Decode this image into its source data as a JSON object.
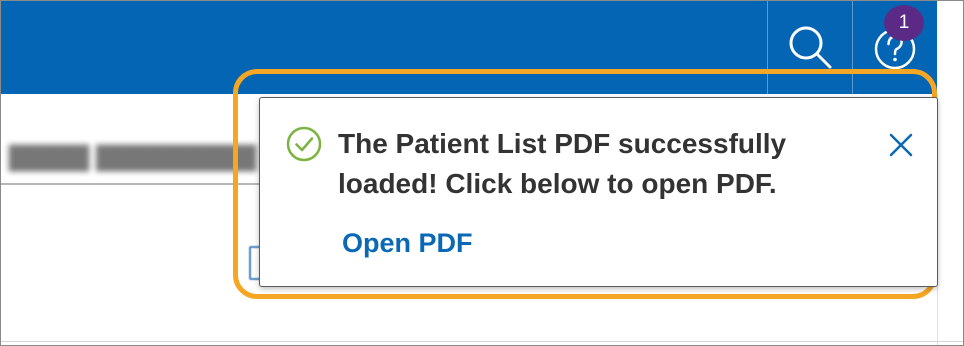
{
  "header": {
    "search_icon": "search-icon",
    "help_icon": "help-icon",
    "notification_count": "1",
    "bar_color": "#0365b4",
    "badge_color": "#5b2a86"
  },
  "toast": {
    "status_icon": "check-circle-icon",
    "message": "The Patient List PDF successfully loaded! Click below to open PDF.",
    "link_label": "Open PDF",
    "close_icon": "close-icon",
    "success_color": "#7cb342",
    "link_color": "#0a68b4"
  },
  "highlight": {
    "color": "#f5a623"
  }
}
